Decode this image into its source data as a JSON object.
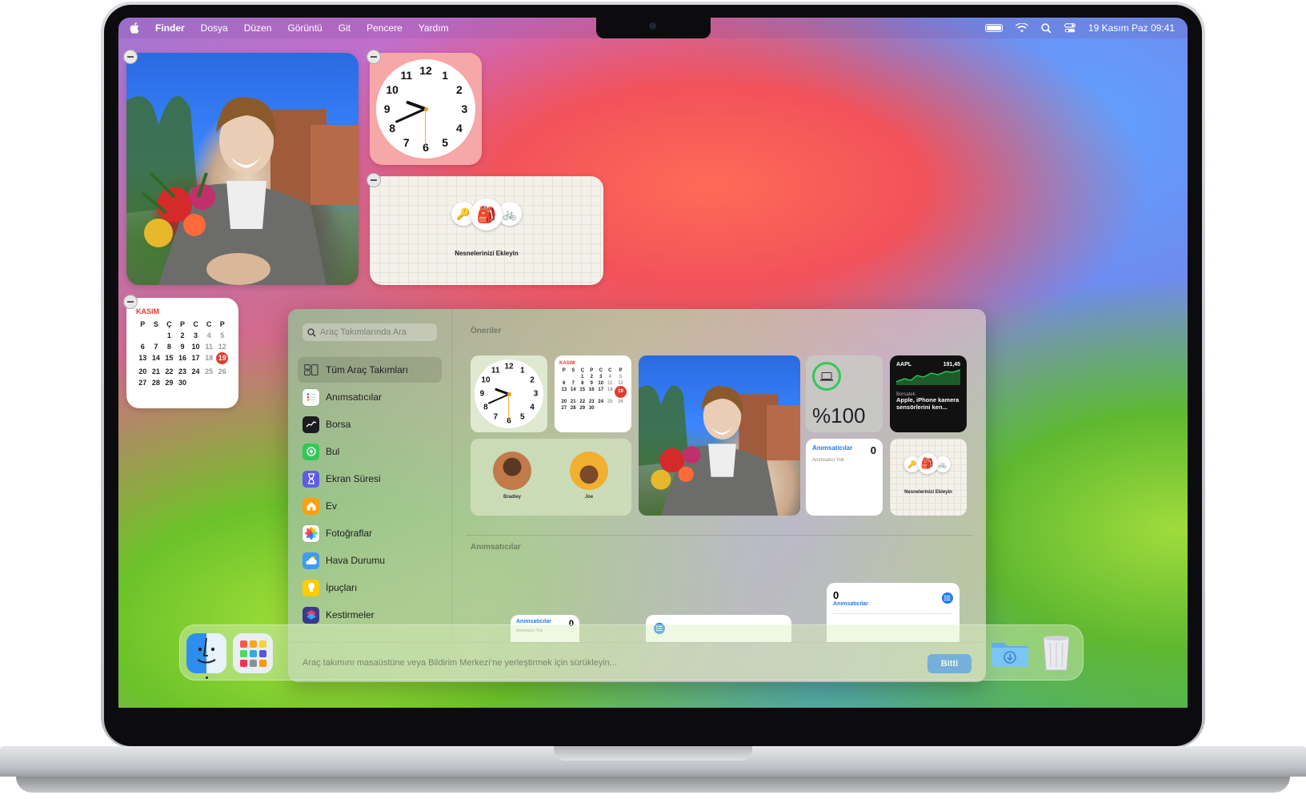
{
  "menubar": {
    "app": "Finder",
    "items": [
      "Dosya",
      "Düzen",
      "Görüntü",
      "Git",
      "Pencere",
      "Yardım"
    ],
    "datetime": "19 Kasım Paz  09:41"
  },
  "clock_numbers": [
    "12",
    "1",
    "2",
    "3",
    "4",
    "5",
    "6",
    "7",
    "8",
    "9",
    "10",
    "11"
  ],
  "calendar": {
    "month": "KASIM",
    "weekdays": [
      "P",
      "S",
      "Ç",
      "P",
      "C",
      "C",
      "P"
    ],
    "days": [
      "",
      "",
      "1",
      "2",
      "3",
      "4",
      "5",
      "6",
      "7",
      "8",
      "9",
      "10",
      "11",
      "12",
      "13",
      "14",
      "15",
      "16",
      "17",
      "18",
      "19",
      "20",
      "21",
      "22",
      "23",
      "24",
      "25",
      "26",
      "27",
      "28",
      "29",
      "30",
      "",
      "",
      ""
    ],
    "today": "19"
  },
  "findmy_widget": {
    "label": "Nesnelerinizi Ekleyin"
  },
  "gallery": {
    "search_placeholder": "Araç Takımlarında Ara",
    "categories": [
      {
        "label": "Tüm Araç Takımları",
        "icon": "widgets-grid-icon"
      },
      {
        "label": "Anımsatıcılar",
        "icon": "reminders-icon"
      },
      {
        "label": "Borsa",
        "icon": "stocks-icon"
      },
      {
        "label": "Bul",
        "icon": "findmy-icon"
      },
      {
        "label": "Ekran Süresi",
        "icon": "screentime-icon"
      },
      {
        "label": "Ev",
        "icon": "home-icon"
      },
      {
        "label": "Fotoğraflar",
        "icon": "photos-icon"
      },
      {
        "label": "Hava Durumu",
        "icon": "weather-icon"
      },
      {
        "label": "İpuçları",
        "icon": "tips-icon"
      },
      {
        "label": "Kestirmeler",
        "icon": "shortcuts-icon"
      }
    ],
    "suggestions_title": "Öneriler",
    "reminders_title": "Anımsatıcılar",
    "battery_value": "%100",
    "stock": {
      "symbol": "AAPL",
      "price": "191,45",
      "source": "Borsatek",
      "headline": "Apple, iPhone kamera sensörlerini ken..."
    },
    "contacts": [
      "Bradley",
      "Joe"
    ],
    "reminders_card": {
      "title": "Anımsatıcılar",
      "count": "0",
      "empty": "Anımsatıcı Yok"
    },
    "findmy_card": "Nesnelerinizi Ekleyin",
    "footer_hint": "Araç takımını masaüstüne veya Bildirim Merkezi’ne yerleştirmek için sürükleyin...",
    "done_label": "Bitti"
  },
  "colors": {
    "accent": "#1f7cf0",
    "calendar_red": "#e23b2e",
    "battery_green": "#34c759"
  }
}
